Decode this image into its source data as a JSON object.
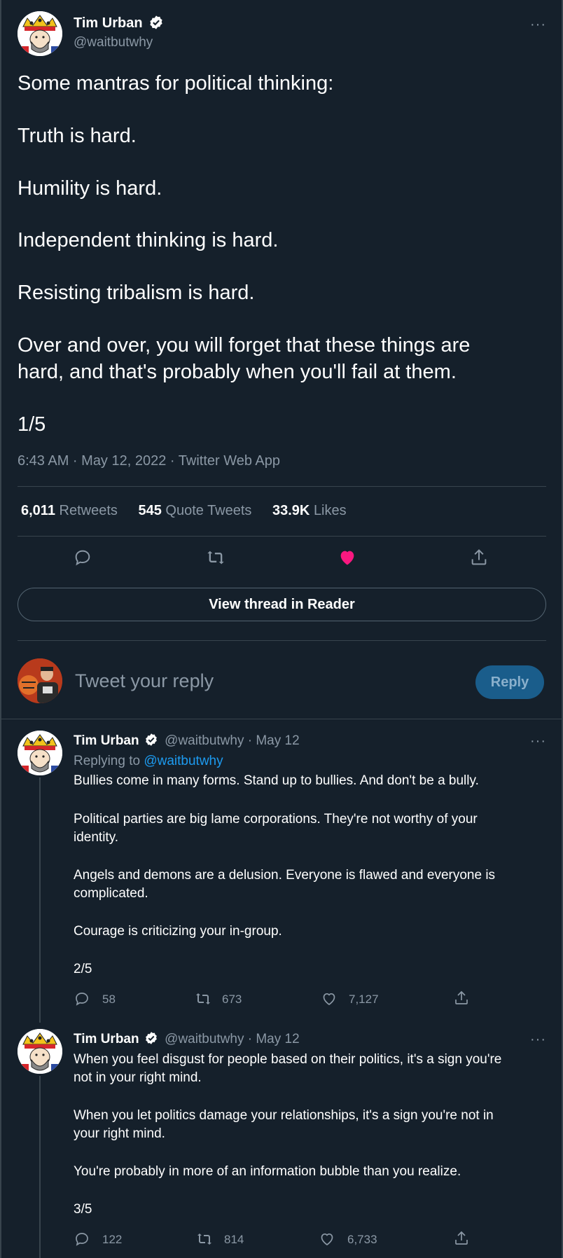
{
  "main_tweet": {
    "author_name": "Tim Urban",
    "author_handle": "@waitbutwhy",
    "lines": [
      "Some mantras for political thinking:",
      "Truth is hard.",
      "Humility is hard.",
      "Independent thinking is hard.",
      "Resisting tribalism is hard.",
      "Over and over, you will forget that these things are",
      "hard, and that's probably when you'll fail at them.",
      "1/5"
    ],
    "meta": "6:43 AM · May 12, 2022 · Twitter Web App",
    "stats": {
      "retweets_value": "6,011",
      "retweets_label": "Retweets",
      "quotes_value": "545",
      "quotes_label": "Quote Tweets",
      "likes_value": "33.9K",
      "likes_label": "Likes"
    },
    "liked_color": "#f91880",
    "more_label": "···"
  },
  "reader_button": "View thread in Reader",
  "composer": {
    "placeholder": "Tweet your reply",
    "reply_button": "Reply"
  },
  "replies": [
    {
      "author_name": "Tim Urban",
      "rest": "@waitbutwhy · May 12",
      "replying_prefix": "Replying to ",
      "replying_handle": "@waitbutwhy",
      "lines": [
        "Bullies come in many forms. Stand up to bullies. And don't be a bully.",
        "Political parties are big lame corporations. They're not worthy of your",
        "identity.",
        "Angels and demons are a delusion. Everyone is flawed and everyone is",
        "complicated.",
        "Courage is criticizing your in-group.",
        "2/5"
      ],
      "replies_count": "58",
      "retweets_count": "673",
      "likes_count": "7,127"
    },
    {
      "author_name": "Tim Urban",
      "rest": "@waitbutwhy · May 12",
      "lines": [
        "When you feel disgust for people based on their politics, it's a sign you're",
        "not in your right mind.",
        "When you let politics damage your relationships, it's a sign you're not in",
        "your right mind.",
        "You're probably in more of an information bubble than you realize.",
        "3/5"
      ],
      "replies_count": "122",
      "retweets_count": "814",
      "likes_count": "6,733"
    }
  ],
  "icons": {
    "reply": "reply-icon",
    "retweet": "retweet-icon",
    "like": "heart-icon",
    "share": "share-icon",
    "verified": "verified-badge-icon"
  }
}
